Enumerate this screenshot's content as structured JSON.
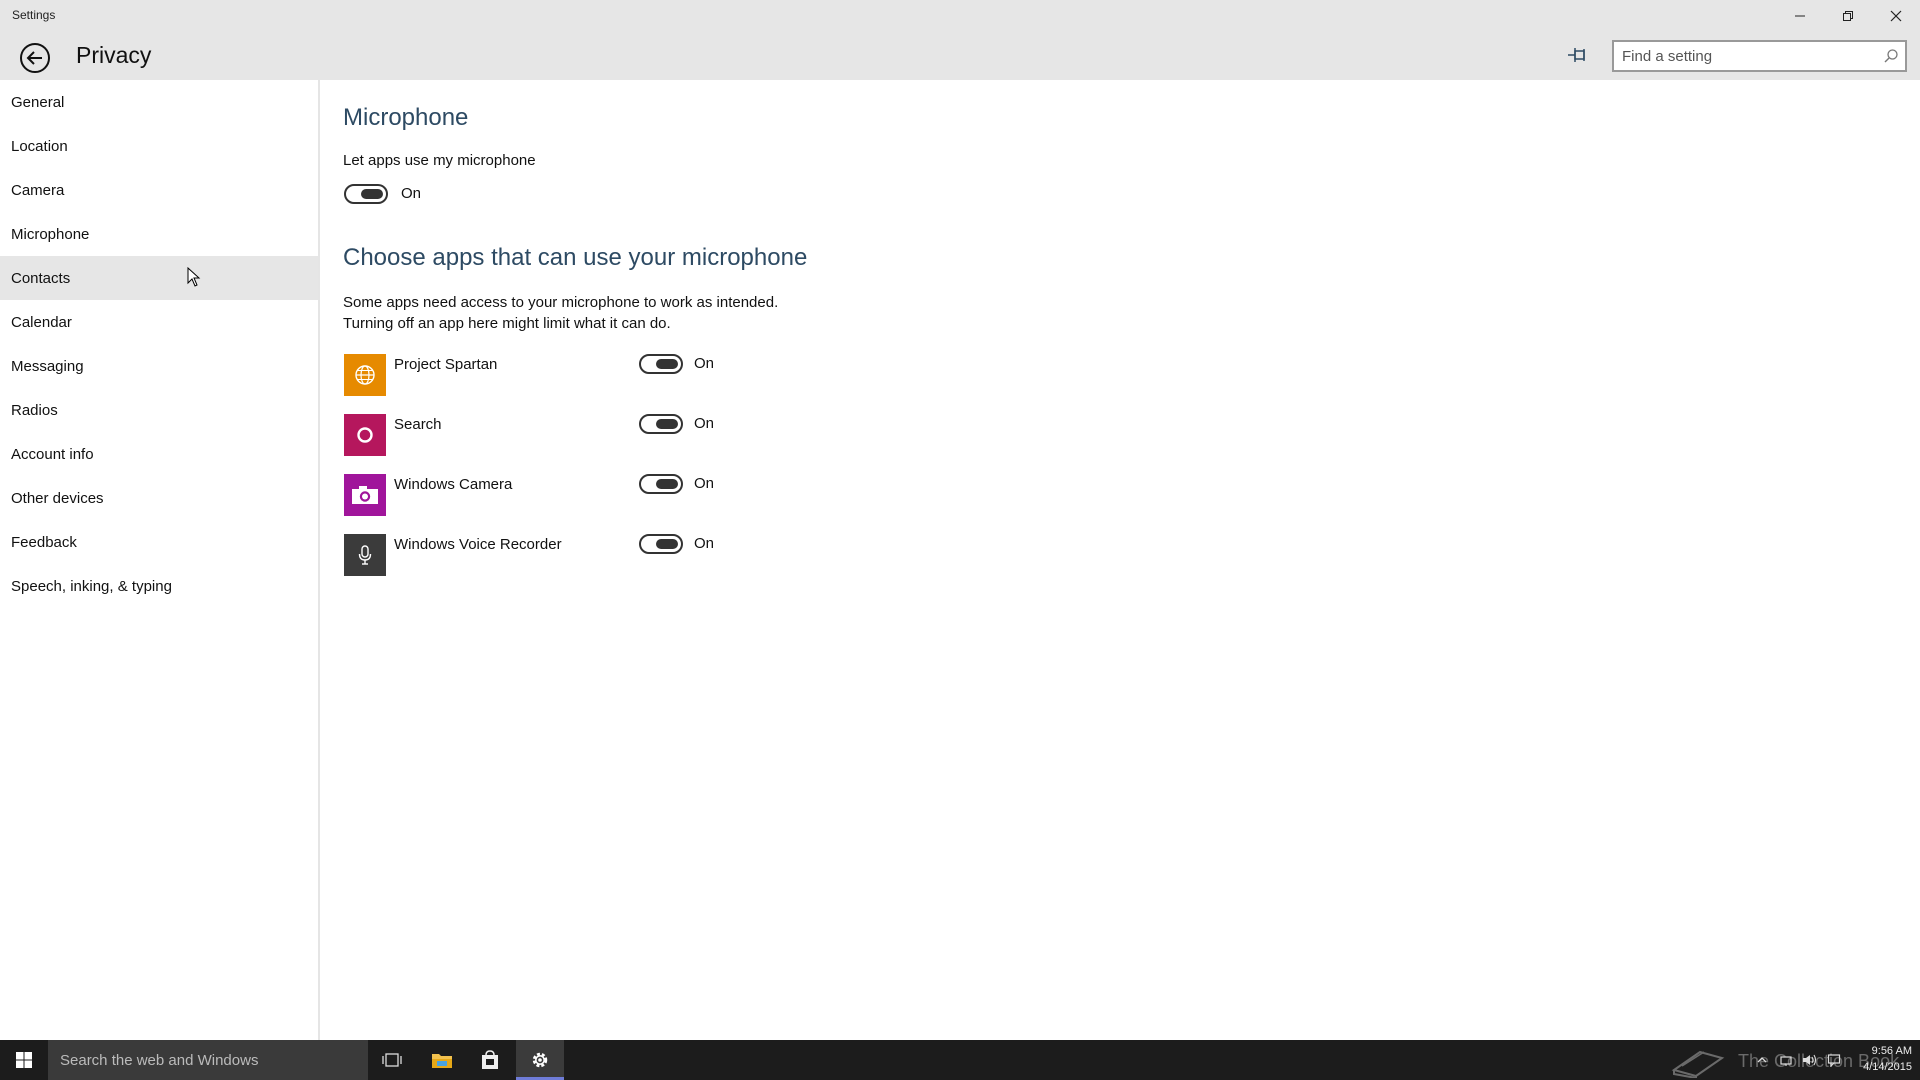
{
  "window": {
    "app_title": "Settings",
    "page_title": "Privacy",
    "search_placeholder": "Find a setting"
  },
  "sidebar": {
    "items": [
      {
        "label": "General"
      },
      {
        "label": "Location"
      },
      {
        "label": "Camera"
      },
      {
        "label": "Microphone"
      },
      {
        "label": "Contacts"
      },
      {
        "label": "Calendar"
      },
      {
        "label": "Messaging"
      },
      {
        "label": "Radios"
      },
      {
        "label": "Account info"
      },
      {
        "label": "Other devices"
      },
      {
        "label": "Feedback"
      },
      {
        "label": "Speech, inking, & typing"
      }
    ],
    "hovered": "Contacts"
  },
  "content": {
    "heading": "Microphone",
    "master_label": "Let apps use my microphone",
    "master_state": "On",
    "apps_heading": "Choose apps that can use your microphone",
    "desc_line1": "Some apps need access to your microphone to work as intended.",
    "desc_line2": "Turning off an app here might limit what it can do.",
    "apps": [
      {
        "name": "Project Spartan",
        "state": "On",
        "color": "#e68a00",
        "icon": "globe-icon"
      },
      {
        "name": "Search",
        "state": "On",
        "color": "#b5175d",
        "icon": "circle-ring-icon"
      },
      {
        "name": "Windows Camera",
        "state": "On",
        "color": "#a0159b",
        "icon": "camera-icon"
      },
      {
        "name": "Windows Voice Recorder",
        "state": "On",
        "color": "#3b3b3b",
        "icon": "microphone-icon"
      }
    ]
  },
  "taskbar": {
    "search_placeholder": "Search the web and Windows",
    "watermark": "The Collection Book",
    "time": "9:56 AM",
    "date": "4/14/2015"
  },
  "colors": {
    "titlebar": "#e6e6e6",
    "heading": "#2d4a63",
    "hover": "#e6e6e6",
    "taskbar": "#1c1c1c",
    "active_indicator": "#6f7cd8"
  }
}
